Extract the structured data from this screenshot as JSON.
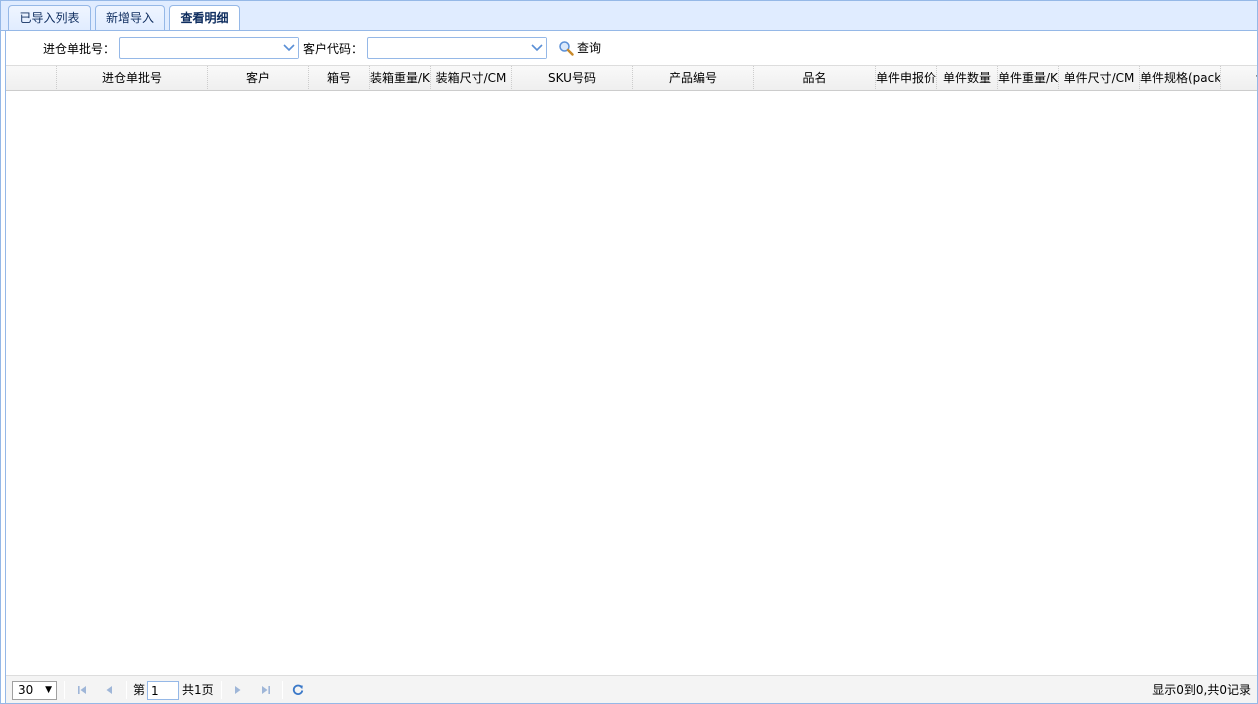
{
  "tabs": [
    {
      "label": "已导入列表",
      "active": false
    },
    {
      "label": "新增导入",
      "active": false
    },
    {
      "label": "查看明细",
      "active": true
    }
  ],
  "toolbar": {
    "batch_label": "进仓单批号：",
    "batch_value": "",
    "customer_label": "客户代码：",
    "customer_value": "",
    "search_label": "查询"
  },
  "grid": {
    "columns": [
      "进仓单批号",
      "客户",
      "箱号",
      "装箱重量/KG",
      "装箱尺寸/CM",
      "SKU号码",
      "产品编号",
      "品名",
      "单件申报价",
      "单件数量",
      "单件重量/KG",
      "单件尺寸/CM",
      "单件规格(pack",
      "专"
    ],
    "rows": []
  },
  "pager": {
    "page_size": "30",
    "page_prefix": "第",
    "page_value": "1",
    "page_suffix": "共1页",
    "info": "显示0到0,共0记录"
  },
  "colors": {
    "border": "#95b8e7",
    "tab_bg": "#e0ecff",
    "tab_text": "#0e2d5f",
    "icon_blue": "#5a8fd6"
  }
}
